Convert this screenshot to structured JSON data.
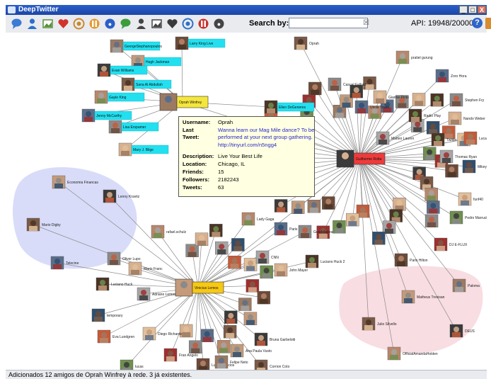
{
  "window": {
    "title": "DeepTwitter",
    "minimize": "_",
    "maximize": "□",
    "close": "X"
  },
  "toolbar": {
    "buttons": [
      {
        "name": "speech-bubble-icon",
        "color": "#3a7bd5"
      },
      {
        "name": "user-follow-icon",
        "color": "#2d6fc9"
      },
      {
        "name": "image-icon",
        "color": "#5b8f3a"
      },
      {
        "name": "heart-icon",
        "color": "#d0342c"
      },
      {
        "name": "users-group-icon",
        "color": "#c9882c"
      },
      {
        "name": "user-orange-icon",
        "color": "#e39a2d"
      },
      {
        "name": "user-blue-icon",
        "color": "#2a5fc9"
      },
      {
        "name": "target-icon",
        "color": "#3b9c3b"
      },
      {
        "name": "q-badge-icon",
        "color": "#444444"
      },
      {
        "name": "pin-icon",
        "color": "#444444"
      },
      {
        "name": "s-badge-icon",
        "color": "#3a3a3a"
      },
      {
        "name": "pause-icon",
        "color": "#2d6fc9"
      },
      {
        "name": "tools-icon",
        "color": "#c9302c"
      },
      {
        "name": "power-icon",
        "color": "#444444"
      }
    ],
    "search_label": "Search by:",
    "search_value": "",
    "search_clear": "☒",
    "api_text": "API: 19948/20000",
    "help_label": "?"
  },
  "colors": {
    "hub_oprah": "#f5e63c",
    "hub_vinicius": "#f7c814",
    "hub_guilherme": "#ee3b3b",
    "cyan_label": "#22e0f0",
    "cluster_blue": "#d9dcf8",
    "cluster_pink": "#f8dde2",
    "edge": "#8a8a8a"
  },
  "graph": {
    "hubs": [
      {
        "label": "Oprah Winfrey"
      },
      {
        "label": "Vinicius Lemos"
      },
      {
        "label": "Guilherme Rotta"
      }
    ],
    "oprah_friends": [
      "Larry King Live",
      "GeorgeStephanopoulos",
      "Hugh Jackman",
      "Evan Williams",
      "Sana Al Abdullah",
      "Gayle King",
      "Jenny McCarthy",
      "Lisa Erspamer",
      "Mary J. Blige",
      "Ellen DeGeneres"
    ],
    "left_nodes": [
      "Economia Financas",
      "Lenny Kravitz",
      "Mario Digby",
      "rafael.schulz",
      "Telecine",
      "Oliver Lupo",
      "Mario Franc",
      "Luciano Huck",
      "Adriane Lemos",
      "temporary",
      "Eva Lundgren",
      "Diego Richards",
      "lucas",
      "Fran Angelo",
      "Lucia Palacios",
      "Felipe Neto",
      "Ana Paula Vusto",
      "Bruna Garbelotti",
      "Corrion Coto",
      "Lady Gaga",
      "Paris Hilton",
      "Guadalajara",
      "John Mayer",
      "Luciano Huck 2",
      "CNN"
    ],
    "right_nodes": [
      "Oprah",
      "pratiel gurung",
      "Zoro Hora",
      "Stephen Fry",
      "Nando Weber",
      "Twitter",
      "Thomas Ryan",
      "Mikey C",
      "Lucas Prado",
      "funf40",
      "Pedro Marrucio",
      "DJ E-FLUX",
      "Paris Hilton",
      "Paloma",
      "Matheus Trevisan",
      "DEUS",
      "Julio Silvello",
      "OfficialAmandaHolden",
      "Uncle Tower",
      "Casual Fallout",
      "Gianne Pinto",
      "Radio Play",
      "Matteo Lauren"
    ]
  },
  "tooltip": {
    "rows": [
      {
        "key": "Username:",
        "value": "Oprah"
      },
      {
        "key": "Last Tweet:",
        "value": "Wanna learn our Mag Mile dance? To be performed at your next group gathering. http://tinyurl.com/n5ngg4"
      },
      {
        "key": "Description:",
        "value": "Live Your Best Life"
      },
      {
        "key": "Location:",
        "value": "Chicago, IL"
      },
      {
        "key": "Friends:",
        "value": "15"
      },
      {
        "key": "Followers:",
        "value": "2182243"
      },
      {
        "key": "Tweets:",
        "value": "63"
      }
    ]
  },
  "status": {
    "text": "Adicionados 12 amigos de Oprah Winfrey à rede. 3 já existentes."
  }
}
